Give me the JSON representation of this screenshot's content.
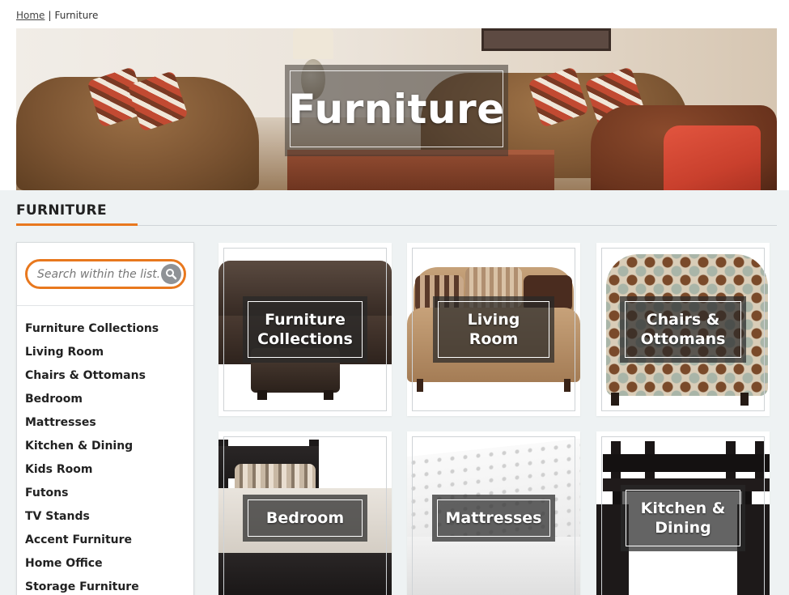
{
  "breadcrumb": {
    "home": "Home",
    "separator": "|",
    "current": "Furniture"
  },
  "hero": {
    "title": "Furniture"
  },
  "section": {
    "title": "FURNITURE",
    "accent_color": "#e8781e"
  },
  "search": {
    "placeholder": "Search within the list..."
  },
  "sidebar": {
    "items": [
      "Furniture Collections",
      "Living Room",
      "Chairs & Ottomans",
      "Bedroom",
      "Mattresses",
      "Kitchen & Dining",
      "Kids Room",
      "Futons",
      "TV Stands",
      "Accent Furniture",
      "Home Office",
      "Storage Furniture"
    ]
  },
  "tiles": [
    {
      "line1": "Furniture",
      "line2": "Collections"
    },
    {
      "line1": "Living",
      "line2": "Room"
    },
    {
      "line1": "Chairs &",
      "line2": "Ottomans"
    },
    {
      "line1": "Bedroom"
    },
    {
      "line1": "Mattresses"
    },
    {
      "line1": "Kitchen &",
      "line2": "Dining"
    }
  ],
  "icons": {
    "search": "search-icon"
  }
}
